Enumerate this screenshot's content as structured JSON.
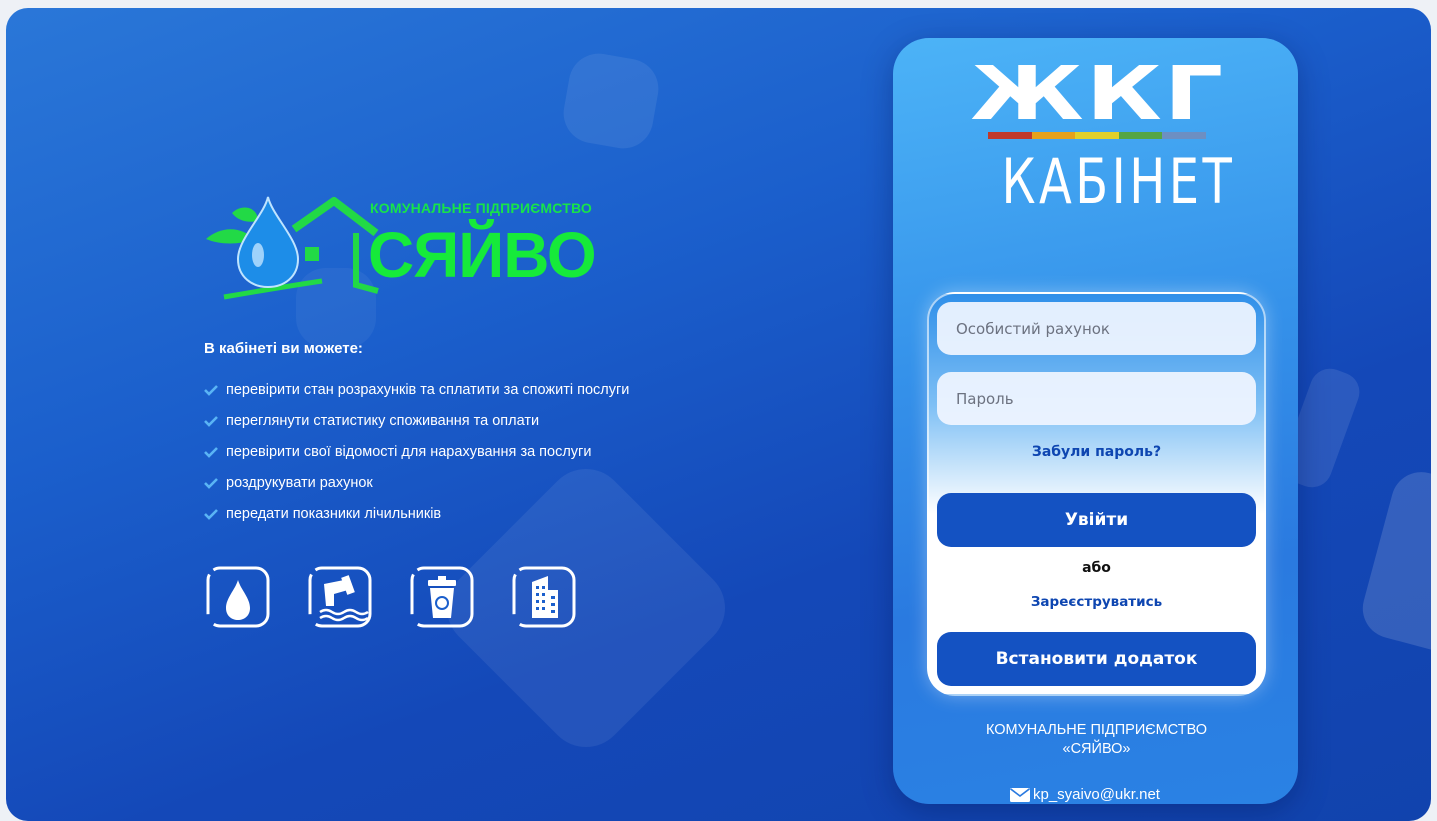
{
  "org_logo": {
    "subtitle": "КОМУНАЛЬНЕ ПІДПРИЄМСТВО",
    "name": "СЯЙВО",
    "accent_color": "#16ea3a"
  },
  "features": {
    "title": "В кабінеті ви можете:",
    "items": [
      "перевірити стан розрахунків та сплатити за спожиті послуги",
      "переглянути статистику споживання та оплати",
      "перевірити свої відомості для нарахування за послуги",
      "роздрукувати рахунок",
      "передати показники лічильників"
    ],
    "check_icon": "check-icon",
    "check_color": "#5ab4f5"
  },
  "services": [
    {
      "icon": "water-drop-icon"
    },
    {
      "icon": "sewage-pipe-icon"
    },
    {
      "icon": "trash-bin-icon"
    },
    {
      "icon": "building-icon"
    }
  ],
  "brand": {
    "top": "ЖКГ",
    "bottom": "КАБІНЕТ",
    "bar_colors": [
      "#c0392b",
      "#e6a11c",
      "#e2d02a",
      "#55a544",
      "#6d8fc2"
    ]
  },
  "login_form": {
    "account_placeholder": "Особистий рахунок",
    "password_placeholder": "Пароль",
    "forgot_link": "Забули пароль?",
    "login_button": "Увійти",
    "or_text": "або",
    "register_link": "Зареєструватись",
    "install_button": "Встановити додаток"
  },
  "footer": {
    "org_line1": "КОМУНАЛЬНЕ ПІДПРИЄМСТВО",
    "org_line2": "«СЯЙВО»",
    "email": "kp_syaivo@ukr.net"
  }
}
